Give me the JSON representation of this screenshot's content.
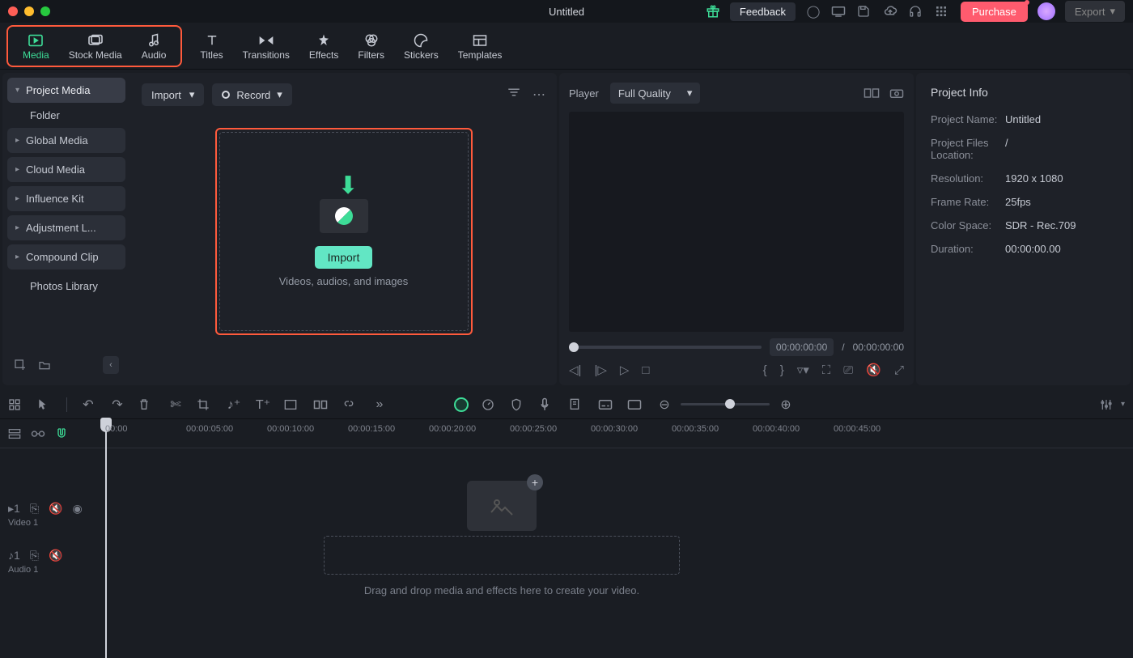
{
  "title": "Untitled",
  "titlebar": {
    "feedback": "Feedback",
    "purchase": "Purchase",
    "export": "Export"
  },
  "tabs": {
    "media": "Media",
    "stock_media": "Stock Media",
    "audio": "Audio",
    "titles": "Titles",
    "transitions": "Transitions",
    "effects": "Effects",
    "filters": "Filters",
    "stickers": "Stickers",
    "templates": "Templates"
  },
  "sidebar": {
    "project_media": "Project Media",
    "folder": "Folder",
    "global_media": "Global Media",
    "cloud_media": "Cloud Media",
    "influence_kit": "Influence Kit",
    "adjustment": "Adjustment L...",
    "compound_clip": "Compound Clip",
    "photos_library": "Photos Library"
  },
  "media_toolbar": {
    "import": "Import",
    "record": "Record"
  },
  "import_zone": {
    "button": "Import",
    "desc": "Videos, audios, and images"
  },
  "player": {
    "label": "Player",
    "quality": "Full Quality",
    "time_current": "00:00:00:00",
    "time_sep": "/",
    "time_total": "00:00:00:00"
  },
  "project_info": {
    "title": "Project Info",
    "name_label": "Project Name:",
    "name_value": "Untitled",
    "loc_label": "Project Files Location:",
    "loc_value": "/",
    "res_label": "Resolution:",
    "res_value": "1920 x 1080",
    "fps_label": "Frame Rate:",
    "fps_value": "25fps",
    "cs_label": "Color Space:",
    "cs_value": "SDR - Rec.709",
    "dur_label": "Duration:",
    "dur_value": "00:00:00.00"
  },
  "timeline": {
    "ruler": [
      "00:00",
      "00:00:05:00",
      "00:00:10:00",
      "00:00:15:00",
      "00:00:20:00",
      "00:00:25:00",
      "00:00:30:00",
      "00:00:35:00",
      "00:00:40:00",
      "00:00:45:00"
    ],
    "video_track": "Video 1",
    "audio_track": "Audio 1",
    "drop_hint": "Drag and drop media and effects here to create your video."
  }
}
